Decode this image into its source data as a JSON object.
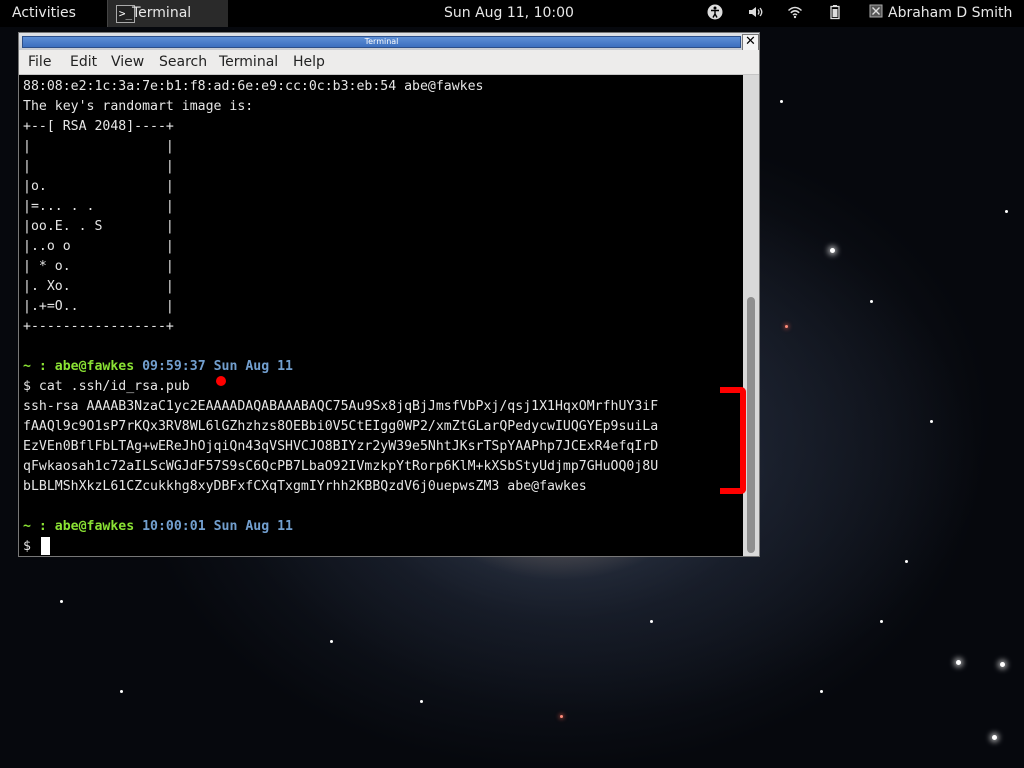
{
  "topbar": {
    "activities": "Activities",
    "app_icon_glyph": ">_",
    "app_name": "Terminal",
    "clock": "Sun Aug 11, 10:00",
    "user_name": "Abraham D Smith",
    "icons": [
      "accessibility-icon",
      "volume-icon",
      "wifi-icon",
      "battery-icon",
      "user-status-icon"
    ]
  },
  "window": {
    "title": "Terminal",
    "close_glyph": "✕",
    "menu": [
      "File",
      "Edit",
      "View",
      "Search",
      "Terminal",
      "Help"
    ]
  },
  "terminal": {
    "fingerprint_line": "88:08:e2:1c:3a:7e:b1:f8:ad:6e:e9:cc:0c:b3:eb:54 abe@fawkes",
    "randomart_header": "The key's randomart image is:",
    "randomart": [
      "+--[ RSA 2048]----+",
      "|                 |",
      "|                 |",
      "|o.               |",
      "|=... . .         |",
      "|oo.E. . S        |",
      "|..o o            |",
      "| * o.            |",
      "|. Xo.            |",
      "|.+=O..           |",
      "+-----------------+"
    ],
    "prompt1": {
      "tilde": "~ : ",
      "user": "abe",
      "host": "@fawkes",
      "time": " 09:59:37 Sun Aug 11"
    },
    "command": "$ cat .ssh/id_rsa.pub",
    "key_lines": [
      "ssh-rsa AAAAB3NzaC1yc2EAAAADAQABAAABAQC75Au9Sx8jqBjJmsfVbPxj/qsj1X1HqxOMrfhUY3iF",
      "fAAQl9c9O1sP7rKQx3RV8WL6lGZhzhzs8OEBbi0V5CtEIgg0WP2/xmZtGLarQPedycwIUQGYEp9suiLa",
      "EzVEn0BflFbLTAg+wEReJhOjqiQn43qVSHVCJO8BIYzr2yW39e5NhtJKsrTSpYAAPhp7JCExR4efqIrD",
      "qFwkaosah1c72aILScWGJdF57S9sC6QcPB7LbaO92IVmzkpYtRorp6KlM+kXSbStyUdjmp7GHuOQ0j8U",
      "bLBLMShXkzL61CZcukkhg8xyDBFxfCXqTxgmIYrhh2KBBQzdV6j0uepwsZM3 abe@fawkes"
    ],
    "prompt2": {
      "tilde": "~ : ",
      "user": "abe",
      "host": "@fawkes",
      "time": " 10:00:01 Sun Aug 11"
    },
    "final_prompt": "$ "
  },
  "colors": {
    "prompt_green": "#8ae234",
    "prompt_blue": "#729fcf",
    "annotation_red": "#ff0000"
  }
}
